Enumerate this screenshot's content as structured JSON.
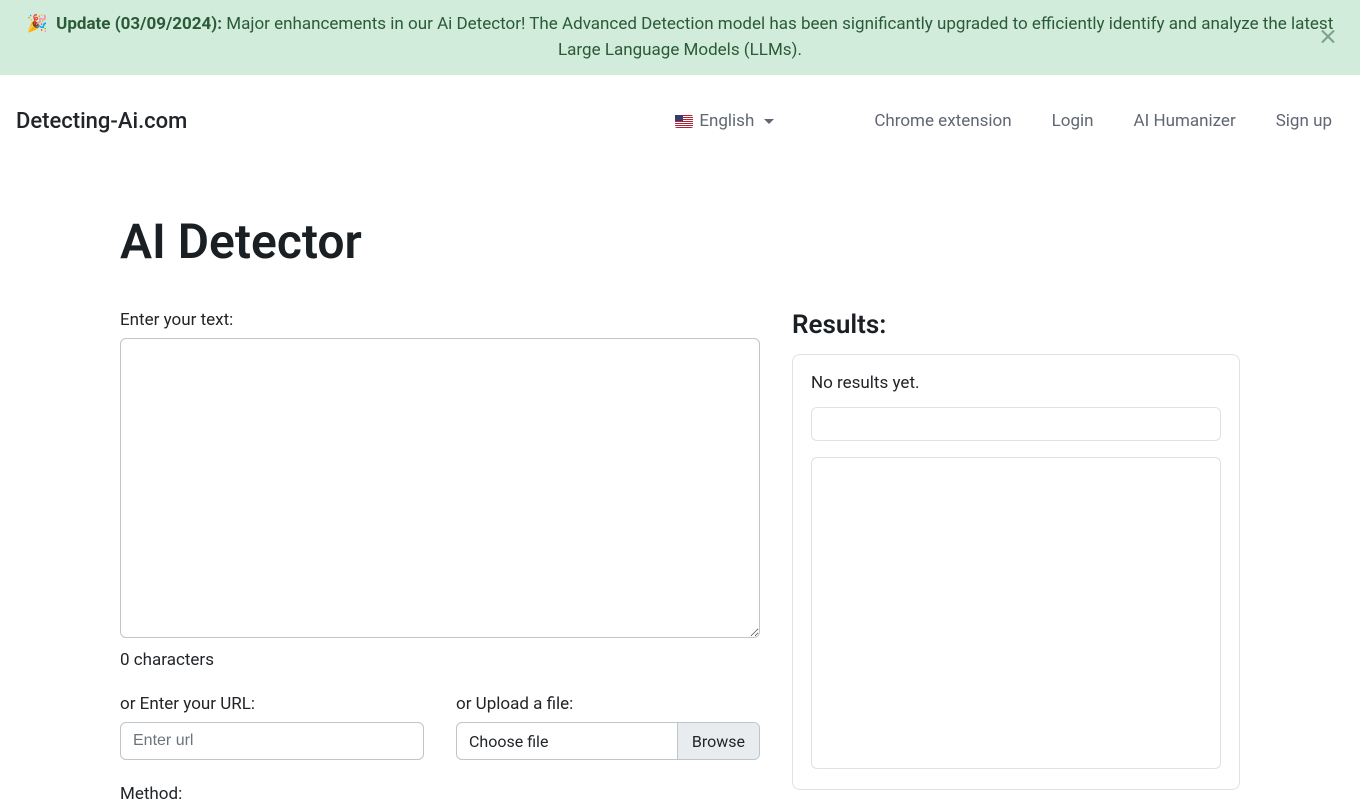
{
  "alert": {
    "emoji": "🎉",
    "strong_text": "Update (03/09/2024):",
    "body_text": " Major enhancements in our Ai Detector! The Advanced Detection model has been significantly upgraded to efficiently identify and analyze the latest Large Language Models (LLMs)."
  },
  "nav": {
    "brand": "Detecting-Ai.com",
    "language": "English",
    "links": {
      "chrome_extension": "Chrome extension",
      "login": "Login",
      "ai_humanizer": "AI Humanizer",
      "sign_up": "Sign up"
    }
  },
  "main": {
    "title": "AI Detector",
    "text_label": "Enter your text:",
    "char_count": "0 characters",
    "url_label": "or Enter your URL:",
    "url_placeholder": "Enter url",
    "file_label": "or Upload a file:",
    "file_choose": "Choose file",
    "file_browse": "Browse",
    "method_label": "Method:"
  },
  "results": {
    "title": "Results:",
    "empty_text": "No results yet."
  }
}
